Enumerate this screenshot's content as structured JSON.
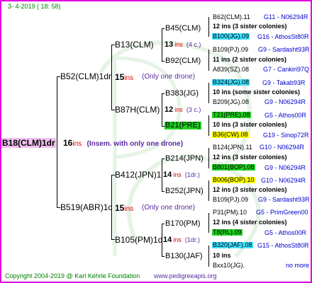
{
  "date": "3-  4-2019 ( 18:  58)",
  "footer": {
    "copyright": "Copyright 2004-2019 @ Karl Kehrle Foundation",
    "website": "www.pedigreeapis.org"
  },
  "colors": {
    "frame": "#e000e0",
    "cyan": "#40e0ff",
    "green": "#20d020",
    "yellow": "#ffff00",
    "root_bg": "#f0c0f0"
  },
  "root": {
    "name": "B18(CLM)1dr",
    "num": "16",
    "ins": "ins",
    "note": "(Insem. with only one drone)"
  },
  "gen1": [
    {
      "name": "B52(CLM)1dr",
      "num": "15",
      "ins": "ins",
      "note": "(Only one drone)"
    },
    {
      "name": "B519(ABR)1c",
      "num": "15",
      "ins": "ins",
      "note": "(Only one drone)"
    }
  ],
  "gen2": [
    {
      "name": "B13(CLM)",
      "num": "13",
      "ins": "ins",
      "note": "(4 c.)"
    },
    {
      "name": "B87H(CLM)",
      "num": "12",
      "ins": "ins",
      "note": "(3 c.)"
    },
    {
      "name": "B412(JPN)1",
      "num": "14",
      "ins": "ins",
      "note": "(1dr.)"
    },
    {
      "name": "B105(PM)1d",
      "num": "14",
      "ins": "ins",
      "note": "(1dr.)"
    }
  ],
  "gen3": [
    {
      "name": "B45(CLM)"
    },
    {
      "name": "B92(CLM)"
    },
    {
      "name": "B383(JG)"
    },
    {
      "name": "B21(PRE)"
    },
    {
      "name": "B214(JPN)"
    },
    {
      "name": "B252(JPN)"
    },
    {
      "name": "B170(PM)"
    },
    {
      "name": "B130(JAF)"
    }
  ],
  "gen4": [
    {
      "name": "B62(CLM).11",
      "code": "G11 - N06294R",
      "sub": "12 ins (3 sister colonies)"
    },
    {
      "name": "B100(JG).09",
      "code": "G16 - AthosSt80R"
    },
    {
      "name": "B109(PJ).09",
      "code": "G9 - Sardasht93R",
      "sub": "11 ins (2 sister colonies)"
    },
    {
      "name": "A839(SZ).08",
      "code": "G7 - Cankiri97Q"
    },
    {
      "name": "B324(JG).08",
      "code": "G9 - Takab93R",
      "sub": "10 ins (some sister colonies)"
    },
    {
      "name": "B209(JG).08",
      "code": "G9 - N06294R"
    },
    {
      "name": "T21(PRE).08",
      "code": "G5 - Athos00R",
      "sub": "10 ins (3 sister colonies)"
    },
    {
      "name": "B36(CW).08",
      "code": "G19 - Sinop72R"
    },
    {
      "name": "B124(JPN).11",
      "code": "G10 - N06294R",
      "sub": "12 ins (3 sister colonies)"
    },
    {
      "name": "B801(BOP).08",
      "code": "G9 - N06294R"
    },
    {
      "name": "B006(BOP).10",
      "code": "G10 - N06294R",
      "sub": "12 ins (3 sister colonies)"
    },
    {
      "name": "B109(PJ).09",
      "code": "G9 - Sardasht93R"
    },
    {
      "name": "P31(PM).10",
      "code": "G5 - PrimGreen00",
      "sub": "12 ins (4 sister colonies)"
    },
    {
      "name": "T8(RL).09",
      "code": "G5 - Athos00R"
    },
    {
      "name": "B320(JAF).08",
      "code": "G15 - AthosSt80R",
      "sub": "10 ins"
    },
    {
      "name": "Bxx10(JG).",
      "code": "no more"
    }
  ]
}
